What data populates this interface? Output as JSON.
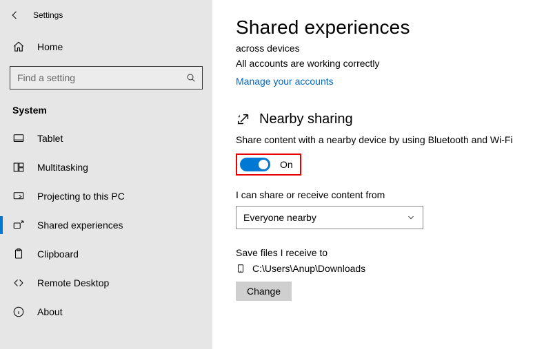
{
  "header": {
    "title": "Settings"
  },
  "home": {
    "label": "Home"
  },
  "search": {
    "placeholder": "Find a setting"
  },
  "group": {
    "label": "System"
  },
  "nav": [
    {
      "label": "Tablet"
    },
    {
      "label": "Multitasking"
    },
    {
      "label": "Projecting to this PC"
    },
    {
      "label": "Shared experiences"
    },
    {
      "label": "Clipboard"
    },
    {
      "label": "Remote Desktop"
    },
    {
      "label": "About"
    }
  ],
  "page": {
    "title": "Shared experiences",
    "cut": "across devices",
    "accounts_status": "All accounts are working correctly",
    "manage_link": "Manage your accounts",
    "nearby_heading": "Nearby sharing",
    "nearby_desc": "Share content with a nearby device by using Bluetooth and Wi-Fi",
    "toggle_label": "On",
    "share_from_label": "I can share or receive content from",
    "share_from_value": "Everyone nearby",
    "save_to_label": "Save files I receive to",
    "save_to_path": "C:\\Users\\Anup\\Downloads",
    "change_btn": "Change"
  }
}
